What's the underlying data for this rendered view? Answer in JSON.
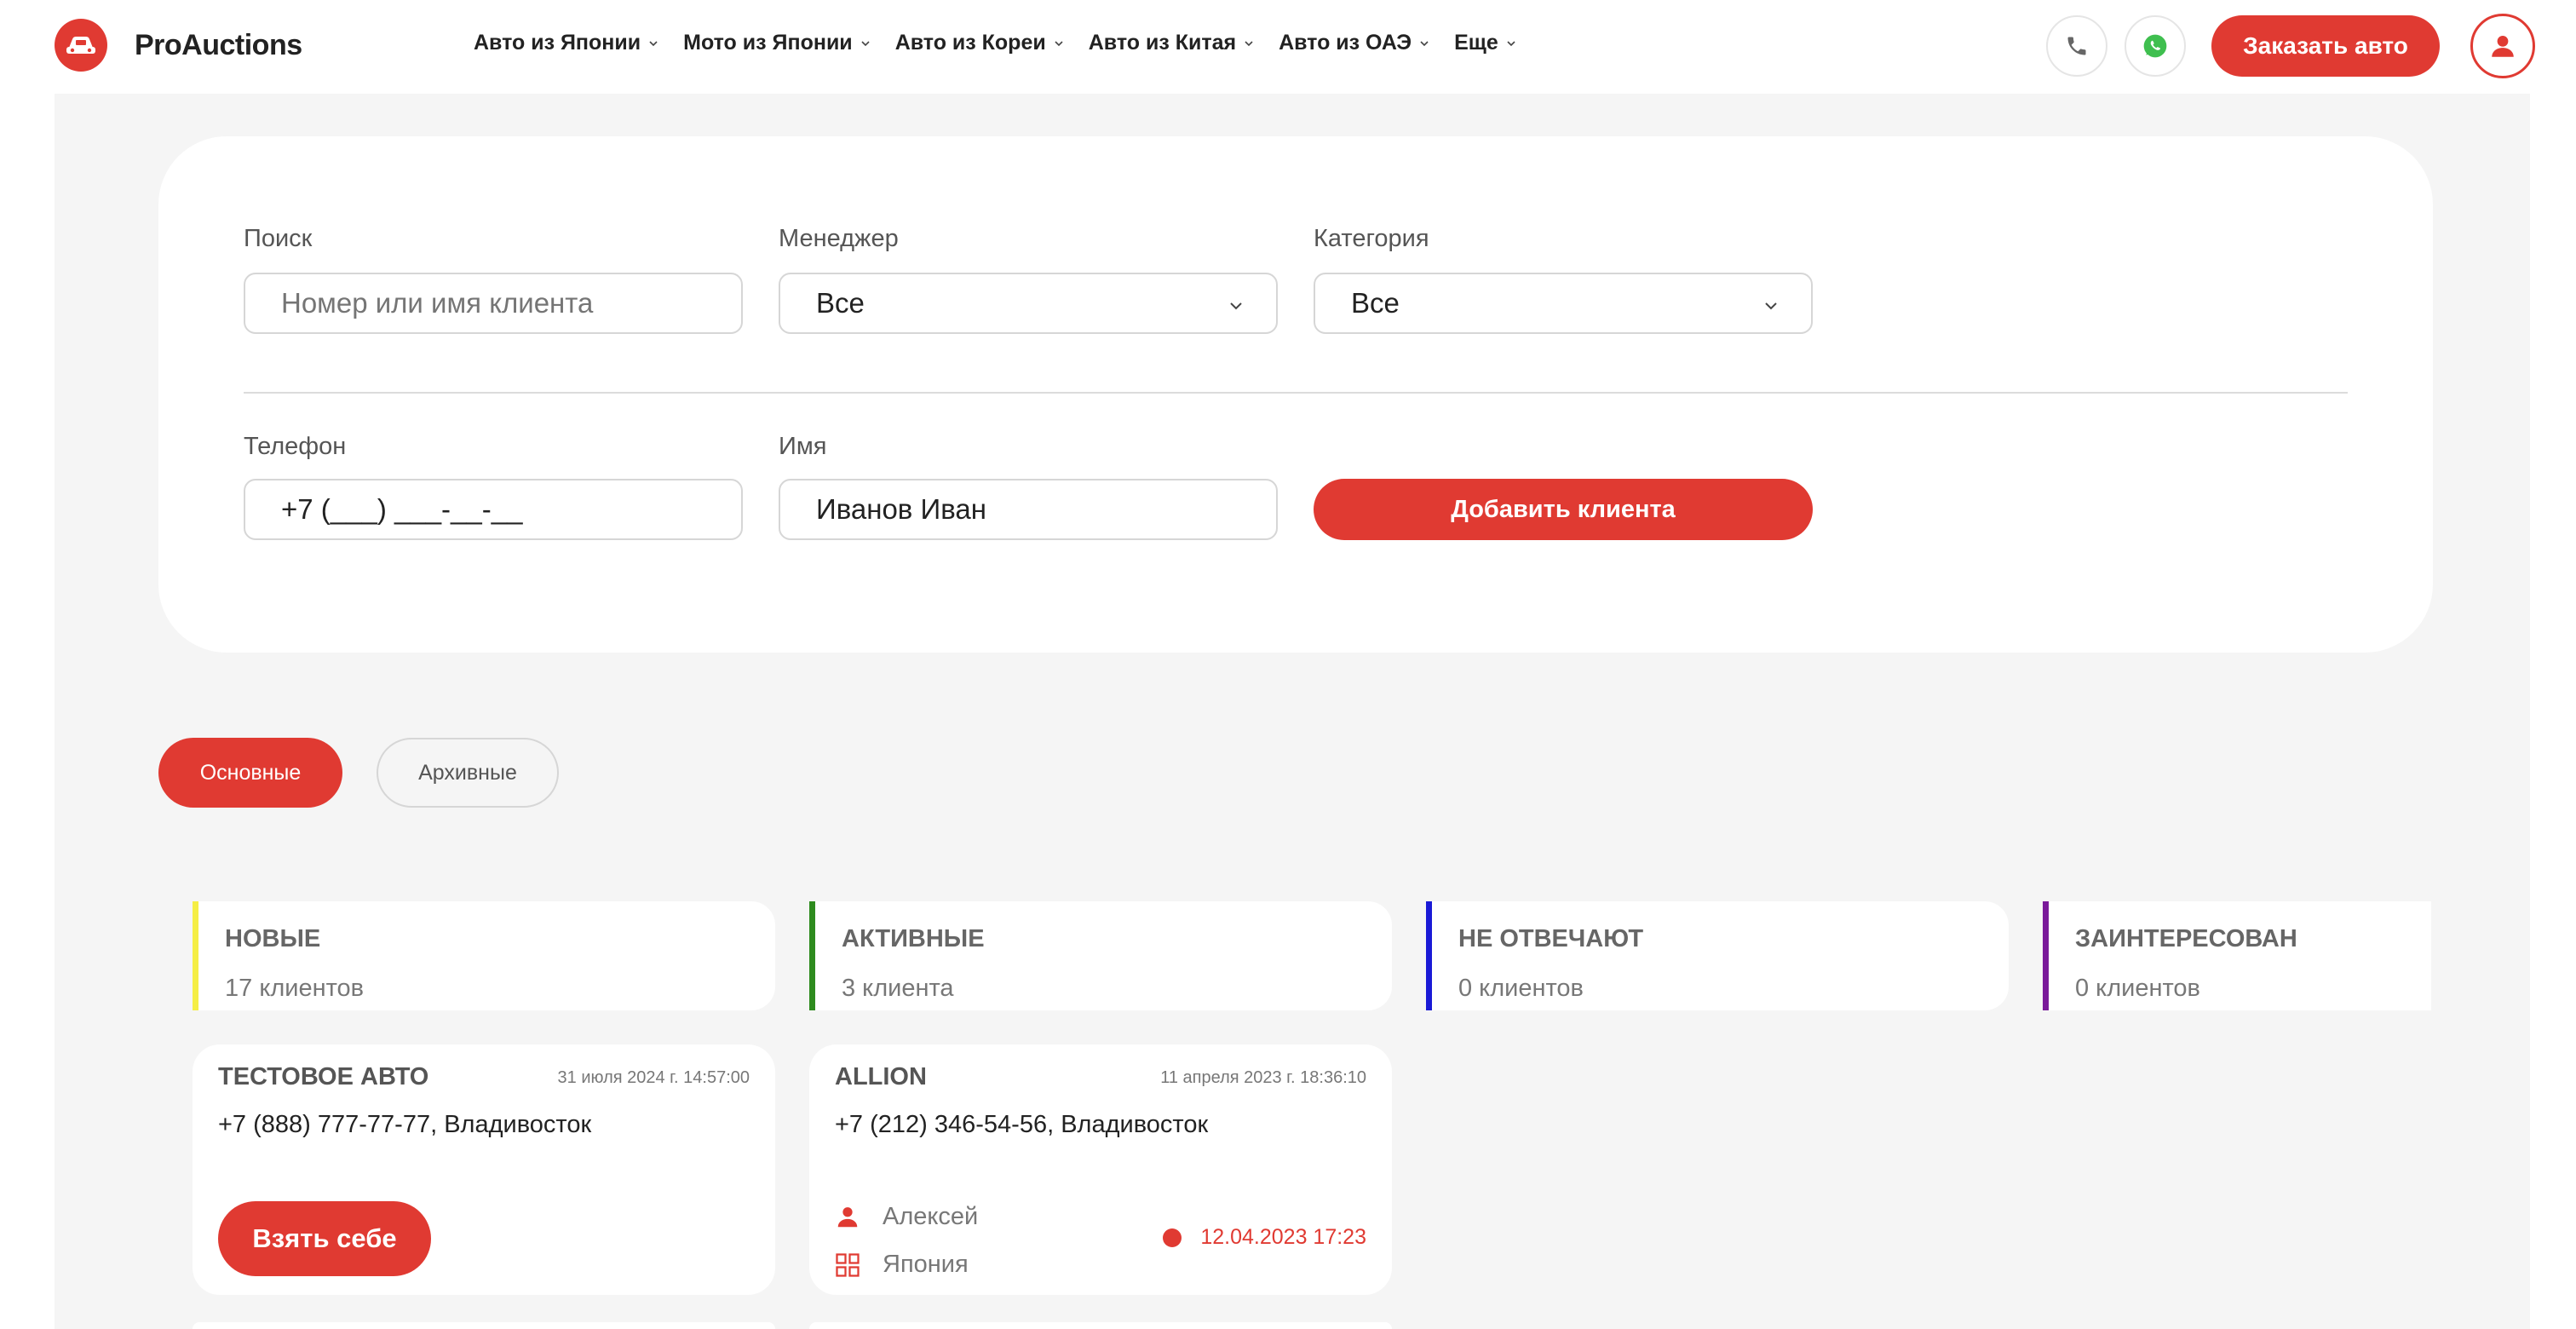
{
  "brand": {
    "name": "ProAuctions",
    "accent": "#e03a32"
  },
  "nav": [
    {
      "label": "Авто из Японии"
    },
    {
      "label": "Мото из Японии"
    },
    {
      "label": "Авто из Кореи"
    },
    {
      "label": "Авто из Китая"
    },
    {
      "label": "Авто из ОАЭ"
    },
    {
      "label": "Еще"
    }
  ],
  "header": {
    "phone_icon": "phone-icon",
    "whatsapp_icon": "whatsapp-icon",
    "order_label": "Заказать авто",
    "user_icon": "user-icon"
  },
  "filters": {
    "search_label": "Поиск",
    "search_placeholder": "Номер или имя клиента",
    "manager_label": "Менеджер",
    "manager_value": "Все",
    "category_label": "Категория",
    "category_value": "Все",
    "phone_label": "Телефон",
    "phone_value": "+7 (___) ___-__-__",
    "name_label": "Имя",
    "name_value": "Иванов Иван",
    "add_label": "Добавить клиента"
  },
  "tabs": [
    {
      "label": "Основные",
      "active": true
    },
    {
      "label": "Архивные",
      "active": false
    }
  ],
  "columns": [
    {
      "title": "НОВЫЕ",
      "count": "17 клиентов",
      "color": "#f5ee45"
    },
    {
      "title": "АКТИВНЫЕ",
      "count": "3 клиента",
      "color": "#2e8b1e"
    },
    {
      "title": "НЕ ОТВЕЧАЮТ",
      "count": "0 клиентов",
      "color": "#1a1ad6"
    },
    {
      "title": "ЗАИНТЕРЕСОВАН",
      "count": "0 клиентов",
      "color": "#7a1a9a"
    }
  ],
  "cards": [
    {
      "title": "ТЕСТОВОЕ АВТО",
      "date": "31 июля 2024 г. 14:57:00",
      "phone": "+7 (888) 777-77-77, Владивосток",
      "action_label": "Взять себе"
    },
    {
      "title": "ALLION",
      "date": "11 апреля 2023 г. 18:36:10",
      "phone": "+7 (212) 346-54-56, Владивосток",
      "manager": "Алексей",
      "country": "Япония",
      "deadline": "12.04.2023 17:23"
    }
  ]
}
